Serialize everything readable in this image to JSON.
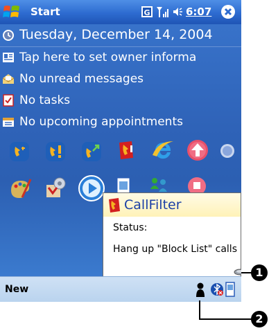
{
  "title_bar": {
    "title": "Start",
    "time": "6:07"
  },
  "today_items": [
    {
      "label": "Tuesday, December 14, 2004",
      "icon": "clock-icon"
    },
    {
      "label": "Tap here to set owner informa",
      "icon": "owner-card-icon"
    },
    {
      "label": "No unread messages",
      "icon": "envelope-icon"
    },
    {
      "label": "No tasks",
      "icon": "tasks-checkbox-icon"
    },
    {
      "label": "No upcoming appointments",
      "icon": "calendar-icon"
    }
  ],
  "notification": {
    "title": "CallFilter",
    "status_label": "Status:",
    "message": "Hang up \"Block List\" calls"
  },
  "bottom_bar": {
    "new_label": "New"
  },
  "callouts": {
    "one": "1",
    "two": "2"
  },
  "colors": {
    "today_bg": "#2f63b8",
    "title_bar": "#2d6bd0",
    "bottom_bar": "#c4daf2"
  }
}
